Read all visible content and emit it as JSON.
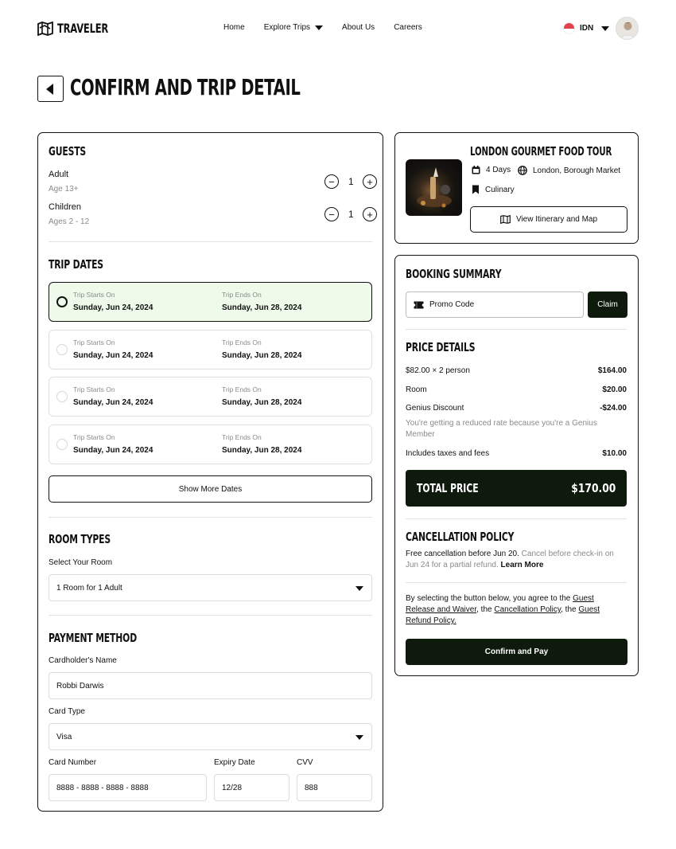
{
  "nav": {
    "logo": "TRAVELER",
    "links": [
      "Home",
      "Explore Trips",
      "About Us",
      "Careers"
    ],
    "language": "IDN"
  },
  "page_title": "CONFIRM AND TRIP DETAIL",
  "guests": {
    "title": "GUESTS",
    "adult": {
      "label": "Adult",
      "sub": "Age 13+",
      "count": "1"
    },
    "children": {
      "label": "Children",
      "sub": "Ages 2 - 12",
      "count": "1"
    }
  },
  "trip_dates": {
    "title": "TRIP DATES",
    "start_label": "Trip Starts On",
    "end_label": "Trip Ends On",
    "options": [
      {
        "start": "Sunday, Jun 24, 2024",
        "end": "Sunday, Jun 28, 2024",
        "selected": true
      },
      {
        "start": "Sunday, Jun 24, 2024",
        "end": "Sunday, Jun 28, 2024",
        "selected": false
      },
      {
        "start": "Sunday, Jun 24, 2024",
        "end": "Sunday, Jun 28, 2024",
        "selected": false
      },
      {
        "start": "Sunday, Jun 24, 2024",
        "end": "Sunday, Jun 28, 2024",
        "selected": false
      }
    ],
    "show_more": "Show More Dates"
  },
  "room_types": {
    "title": "ROOM TYPES",
    "select_label": "Select Your Room",
    "selected": "1 Room for 1 Adult"
  },
  "payment": {
    "title": "PAYMENT METHOD",
    "cardholder_label": "Cardholder's Name",
    "cardholder_value": "Robbi Darwis",
    "card_type_label": "Card Type",
    "card_type_value": "Visa",
    "card_number_label": "Card Number",
    "card_number_value": "8888 - 8888 - 8888 - 8888",
    "expiry_label": "Expiry Date",
    "expiry_value": "12/28",
    "cvv_label": "CVV",
    "cvv_value": "888"
  },
  "tour": {
    "title": "LONDON GOURMET FOOD TOUR",
    "duration": "4 Days",
    "location": "London, Borough Market",
    "category": "Culinary",
    "itinerary_button": "View Itinerary and Map"
  },
  "booking": {
    "title": "BOOKING SUMMARY",
    "promo_placeholder": "Promo Code",
    "claim": "Claim",
    "price_title": "PRICE DETAILS",
    "rows": [
      {
        "label": "$82.00 × 2 person",
        "value": "$164.00"
      },
      {
        "label": "Room",
        "value": "$20.00"
      },
      {
        "label": "Genius Discount",
        "value": "-$24.00"
      }
    ],
    "genius_note": "You're getting a reduced rate because you're a Genius Member",
    "taxes": {
      "label": "Includes taxes and fees",
      "value": "$10.00"
    },
    "total_label": "TOTAL PRICE",
    "total_value": "$170.00",
    "cancel_title": "CANCELLATION POLICY",
    "cancel_bold": "Free cancellation before Jun 20.",
    "cancel_rest": "Cancel before check-in on Jun 24 for a partial refund.",
    "learn_more": "Learn More",
    "agree_1": "By selecting the button below, you agree to the",
    "agree_link_1": "Guest Release and Waiver",
    "agree_2": ", the",
    "agree_link_2": "Cancellation Policy",
    "agree_3": ", the",
    "agree_link_3": "Guest Refund Policy.",
    "confirm_button": "Confirm and Pay"
  }
}
